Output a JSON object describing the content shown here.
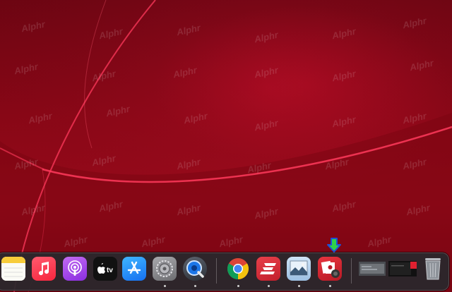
{
  "watermark": {
    "text": "Alphr"
  },
  "colors": {
    "wallpaper_base": "#8a0716",
    "wallpaper_glow": "#ff2a4a",
    "dock_bg": "#28282c",
    "arrow_fill": "#2fd14a",
    "arrow_outline": "#1e4fd6"
  },
  "dock": {
    "apps": [
      {
        "name": "Notes",
        "icon": "notes-icon",
        "running": false
      },
      {
        "name": "Music",
        "icon": "music-icon",
        "running": false
      },
      {
        "name": "Podcasts",
        "icon": "podcasts-icon",
        "running": false
      },
      {
        "name": "TV",
        "icon": "apple-tv-icon",
        "label": "tv",
        "running": false
      },
      {
        "name": "App Store",
        "icon": "app-store-icon",
        "running": false
      },
      {
        "name": "System Preferences",
        "icon": "gear-icon",
        "running": true
      },
      {
        "name": "QuickTime Player",
        "icon": "quicktime-icon",
        "running": true
      },
      {
        "name": "Google Chrome",
        "icon": "chrome-icon",
        "running": true
      },
      {
        "name": "ExpressVPN",
        "icon": "expressvpn-icon",
        "running": true
      },
      {
        "name": "Preview",
        "icon": "preview-icon",
        "running": true
      },
      {
        "name": "Photo Booth",
        "icon": "photo-booth-icon",
        "running": true
      }
    ],
    "minimized": [
      {
        "name": "Minimized window 1",
        "icon": "window-thumbnail-icon"
      },
      {
        "name": "Minimized window 2",
        "icon": "window-thumbnail-icon"
      },
      {
        "name": "Trash",
        "icon": "trash-icon"
      }
    ]
  },
  "annotation": {
    "icon": "arrow-down-icon",
    "target": "Photo Booth"
  }
}
